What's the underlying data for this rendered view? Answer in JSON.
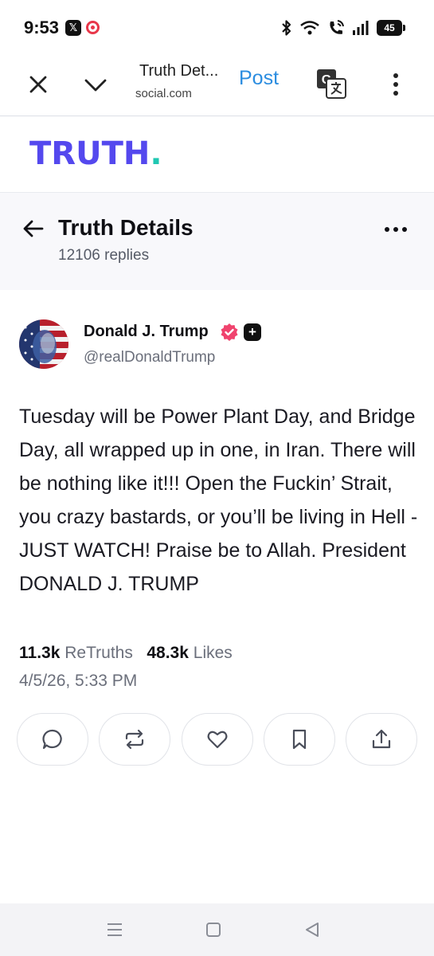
{
  "status_bar": {
    "time": "9:53",
    "battery": "45",
    "app_icons": [
      "x-app-icon",
      "recording-app-icon"
    ],
    "system_icons": [
      "bluetooth-icon",
      "wifi-icon",
      "wifi-calling-icon",
      "signal-icon",
      "battery-icon"
    ]
  },
  "browser": {
    "page_title": "Truth Det...",
    "url": "social.com",
    "post_label": "Post"
  },
  "site": {
    "logo_text": "TRUTH",
    "logo_dot": ".",
    "brand_color": "#5448ee",
    "accent_color": "#20c7b2"
  },
  "details": {
    "title": "Truth Details",
    "replies": "12106 replies"
  },
  "post": {
    "author_name": "Donald J. Trump",
    "author_handle": "@realDonaldTrump",
    "verified_color": "#f0436e",
    "body": "Tuesday will be Power Plant Day, and Bridge Day, all wrapped up in one, in Iran. There will be nothing like it!!! Open the Fuckin’ Strait, you crazy bastards, or you’ll be living in Hell - JUST WATCH! Praise be to Allah. President DONALD J. TRUMP",
    "retruths_count": "11.3k",
    "retruths_label": "ReTruths",
    "likes_count": "48.3k",
    "likes_label": "Likes",
    "timestamp": "4/5/26, 5:33 PM"
  },
  "actions": [
    "reply-icon",
    "retruth-icon",
    "like-icon",
    "bookmark-icon",
    "share-icon"
  ],
  "nav": [
    "recents-icon",
    "home-icon",
    "back-icon"
  ]
}
